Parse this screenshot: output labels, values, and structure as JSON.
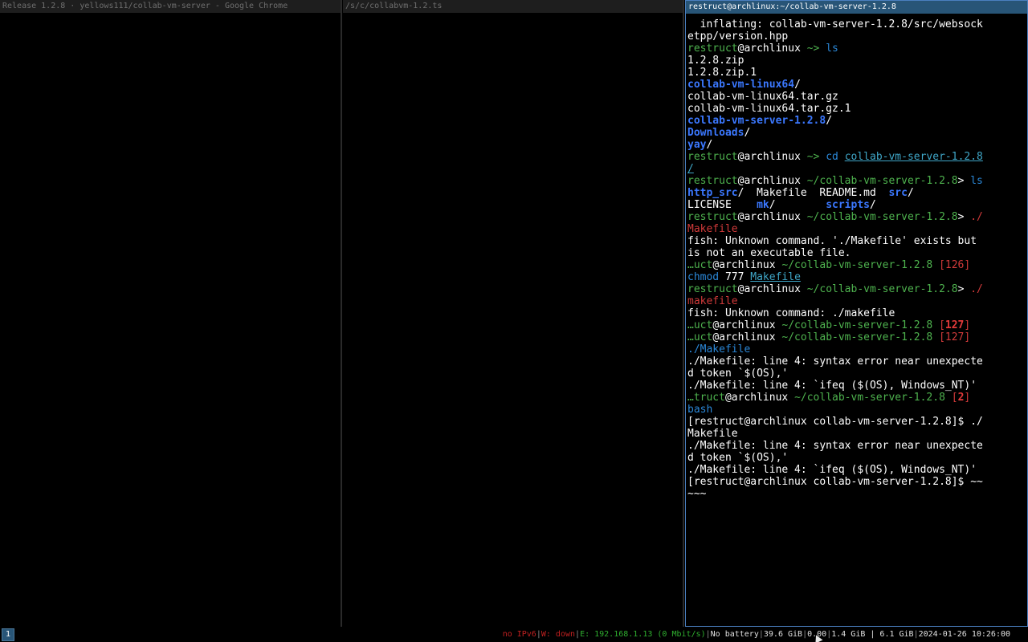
{
  "windows": {
    "chrome": {
      "title": "Release 1.2.8 · yellows111/collab-vm-server - Google Chrome"
    },
    "editor": {
      "title": "/s/c/collabvm-1.2.ts"
    },
    "terminal": {
      "title": "restruct@archlinux:~/collab-vm-server-1.2.8"
    }
  },
  "terminal_lines": [
    [
      {
        "t": "  inflating: collab-vm-server-1.2.8/src/websock",
        "c": "white"
      }
    ],
    [
      {
        "t": "etpp/version.hpp",
        "c": "white"
      }
    ],
    [
      {
        "t": "restruct",
        "c": "green"
      },
      {
        "t": "@archlinux ",
        "c": "white"
      },
      {
        "t": "~> ",
        "c": "green"
      },
      {
        "t": "ls",
        "c": "cyan"
      }
    ],
    [
      {
        "t": "1.2.8.zip",
        "c": "white"
      }
    ],
    [
      {
        "t": "1.2.8.zip.1",
        "c": "white"
      }
    ],
    [
      {
        "t": "collab-vm-linux64",
        "c": "bluebold"
      },
      {
        "t": "/",
        "c": "white"
      }
    ],
    [
      {
        "t": "collab-vm-linux64.tar.gz",
        "c": "white"
      }
    ],
    [
      {
        "t": "collab-vm-linux64.tar.gz.1",
        "c": "white"
      }
    ],
    [
      {
        "t": "collab-vm-server-1.2.8",
        "c": "bluebold"
      },
      {
        "t": "/",
        "c": "white"
      }
    ],
    [
      {
        "t": "Downloads",
        "c": "bluebold"
      },
      {
        "t": "/",
        "c": "white"
      }
    ],
    [
      {
        "t": "yay",
        "c": "bluebold"
      },
      {
        "t": "/",
        "c": "white"
      }
    ],
    [
      {
        "t": "restruct",
        "c": "green"
      },
      {
        "t": "@archlinux ",
        "c": "white"
      },
      {
        "t": "~> ",
        "c": "green"
      },
      {
        "t": "cd ",
        "c": "cyan"
      },
      {
        "t": "collab-vm-server-1.2.8",
        "c": "teal",
        "u": true
      }
    ],
    [
      {
        "t": "/",
        "c": "teal",
        "u": true
      }
    ],
    [
      {
        "t": "restruct",
        "c": "green"
      },
      {
        "t": "@archlinux ",
        "c": "white"
      },
      {
        "t": "~/collab-vm-server-1.2.8",
        "c": "green"
      },
      {
        "t": "> ",
        "c": "white"
      },
      {
        "t": "ls",
        "c": "cyan"
      }
    ],
    [
      {
        "t": "http_src",
        "c": "bluebold"
      },
      {
        "t": "/  Makefile  README.md  ",
        "c": "white"
      },
      {
        "t": "src",
        "c": "bluebold"
      },
      {
        "t": "/",
        "c": "white"
      }
    ],
    [
      {
        "t": "LICENSE    ",
        "c": "white"
      },
      {
        "t": "mk",
        "c": "bluebold"
      },
      {
        "t": "/        ",
        "c": "white"
      },
      {
        "t": "scripts",
        "c": "bluebold"
      },
      {
        "t": "/",
        "c": "white"
      }
    ],
    [
      {
        "t": "restruct",
        "c": "green"
      },
      {
        "t": "@archlinux ",
        "c": "white"
      },
      {
        "t": "~/collab-vm-server-1.2.8",
        "c": "green"
      },
      {
        "t": "> ",
        "c": "white"
      },
      {
        "t": "./",
        "c": "red"
      }
    ],
    [
      {
        "t": "Makefile",
        "c": "red"
      }
    ],
    [
      {
        "t": "fish: Unknown command. './Makefile' exists but",
        "c": "white"
      }
    ],
    [
      {
        "t": "is not an executable file.",
        "c": "white"
      }
    ],
    [
      {
        "t": "…uct",
        "c": "green"
      },
      {
        "t": "@archlinux ",
        "c": "white"
      },
      {
        "t": "~/collab-vm-server-1.2.8 ",
        "c": "green"
      },
      {
        "t": "[126]",
        "c": "red"
      }
    ],
    [
      {
        "t": "chmod ",
        "c": "cyan"
      },
      {
        "t": "777 ",
        "c": "white"
      },
      {
        "t": "Makefile",
        "c": "teal",
        "u": true
      }
    ],
    [
      {
        "t": "restruct",
        "c": "green"
      },
      {
        "t": "@archlinux ",
        "c": "white"
      },
      {
        "t": "~/collab-vm-server-1.2.8",
        "c": "green"
      },
      {
        "t": "> ",
        "c": "white"
      },
      {
        "t": "./",
        "c": "red"
      }
    ],
    [
      {
        "t": "makefile",
        "c": "red"
      }
    ],
    [
      {
        "t": "fish: Unknown command: ./makefile",
        "c": "white"
      }
    ],
    [
      {
        "t": "…uct",
        "c": "green"
      },
      {
        "t": "@archlinux ",
        "c": "white"
      },
      {
        "t": "~/collab-vm-server-1.2.8 ",
        "c": "green"
      },
      {
        "t": "[",
        "c": "red"
      },
      {
        "t": "127",
        "c": "redbold"
      },
      {
        "t": "]",
        "c": "red"
      }
    ],
    [
      {
        "t": "…uct",
        "c": "green"
      },
      {
        "t": "@archlinux ",
        "c": "white"
      },
      {
        "t": "~/collab-vm-server-1.2.8 ",
        "c": "green"
      },
      {
        "t": "[127]",
        "c": "red"
      }
    ],
    [
      {
        "t": "./Makefile",
        "c": "cyan"
      }
    ],
    [
      {
        "t": "./Makefile: line 4: syntax error near unexpecte",
        "c": "white"
      }
    ],
    [
      {
        "t": "d token `$(OS),'",
        "c": "white"
      }
    ],
    [
      {
        "t": "./Makefile: line 4: `ifeq ($(OS), Windows_NT)'",
        "c": "white"
      }
    ],
    [
      {
        "t": "…truct",
        "c": "green"
      },
      {
        "t": "@archlinux ",
        "c": "white"
      },
      {
        "t": "~/collab-vm-server-1.2.8 ",
        "c": "green"
      },
      {
        "t": "[",
        "c": "red"
      },
      {
        "t": "2",
        "c": "redbold"
      },
      {
        "t": "]",
        "c": "red"
      }
    ],
    [
      {
        "t": "bash",
        "c": "cyan"
      }
    ],
    [
      {
        "t": "[restruct@archlinux collab-vm-server-1.2.8]$ ./",
        "c": "white"
      }
    ],
    [
      {
        "t": "Makefile",
        "c": "white"
      }
    ],
    [
      {
        "t": "./Makefile: line 4: syntax error near unexpecte",
        "c": "white"
      }
    ],
    [
      {
        "t": "d token `$(OS),'",
        "c": "white"
      }
    ],
    [
      {
        "t": "./Makefile: line 4: `ifeq ($(OS), Windows_NT)'",
        "c": "white"
      }
    ],
    [
      {
        "t": "[restruct@archlinux collab-vm-server-1.2.8]$ ~~",
        "c": "white"
      }
    ],
    [
      {
        "t": "~~~",
        "c": "white"
      }
    ]
  ],
  "bar": {
    "workspace": "1",
    "status": [
      {
        "t": "no IPv6",
        "c": "red"
      },
      {
        "t": "W: down",
        "c": "red"
      },
      {
        "t": "E: 192.168.1.13 (0 Mbit/s)",
        "c": "green"
      },
      {
        "t": "No battery",
        "c": "plain"
      },
      {
        "t": "39.6 GiB",
        "c": "plain"
      },
      {
        "t": "0.00",
        "c": "plain"
      },
      {
        "t": "1.4 GiB | 6.1 GiB",
        "c": "plain"
      },
      {
        "t": "2024-01-26 10:26:00",
        "c": "plain"
      }
    ]
  },
  "colors": {
    "focused_title": "#285577",
    "prompt_user": "#4eb24e",
    "command": "#2b88d8",
    "error": "#d13a3a"
  }
}
